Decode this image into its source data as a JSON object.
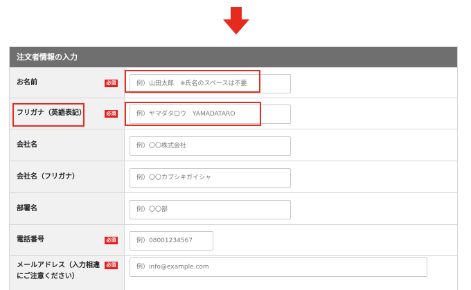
{
  "arrow": {
    "icon": "down-arrow-icon",
    "color": "#e62a1e"
  },
  "form": {
    "section_title": "注文者情報の入力",
    "required_badge": "必須",
    "fields": [
      {
        "label": "お名前",
        "required": true,
        "placeholder": "例）山田太郎　※氏名のスペースは不要"
      },
      {
        "label": "フリガナ（英語表記）",
        "required": true,
        "placeholder": "例）ヤマダタロウ　YAMADATARO"
      },
      {
        "label": "会社名",
        "required": false,
        "placeholder": "例）〇〇株式会社"
      },
      {
        "label": "会社名（フリガナ）",
        "required": false,
        "placeholder": "例）〇〇カブシキガイシャ"
      },
      {
        "label": "部署名",
        "required": false,
        "placeholder": "例）〇〇部"
      },
      {
        "label": "電話番号",
        "required": true,
        "placeholder": "例）08001234567"
      },
      {
        "label_line1": "メールアドレス（入力相違",
        "label_line2": "にご注意ください）",
        "required": true,
        "placeholder": "例）info@example.com"
      }
    ]
  },
  "colors": {
    "header_bg": "#6f6f6f",
    "badge": "#e32020",
    "highlight": "#e62a1e",
    "label_bg": "#f1f1f1"
  }
}
